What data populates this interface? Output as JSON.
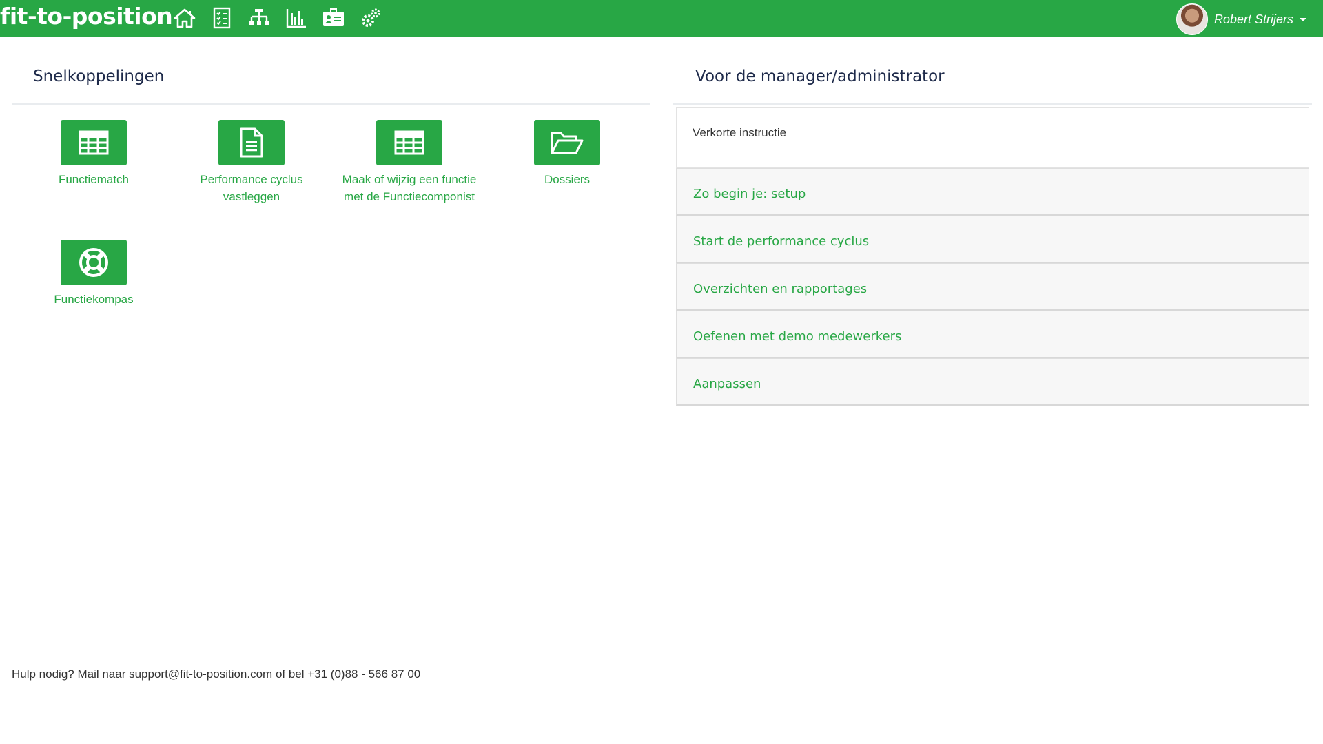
{
  "brand": {
    "logo_text": "fit-to-position",
    "color": "#28a745"
  },
  "nav": {
    "icons": [
      "home-icon",
      "checklist-icon",
      "org-chart-icon",
      "bar-chart-icon",
      "id-card-icon",
      "settings-icon"
    ]
  },
  "user": {
    "name": "Robert Strijers"
  },
  "left": {
    "title": "Snelkoppelingen",
    "tiles": [
      {
        "label": "Functiematch",
        "icon": "table-icon"
      },
      {
        "label": "Performance cyclus vastleggen",
        "icon": "document-icon"
      },
      {
        "label": "Maak of wijzig een functie met de Functiecomponist",
        "icon": "table-icon"
      },
      {
        "label": "Dossiers",
        "icon": "folder-open-icon"
      },
      {
        "label": "Functiekompas",
        "icon": "lifebuoy-icon"
      }
    ]
  },
  "right": {
    "title": "Voor de manager/administrator",
    "card_title": "Verkorte instructie",
    "items": [
      "Zo begin je: setup",
      "Start de performance cyclus",
      "Overzichten en rapportages",
      "Oefenen met demo medewerkers",
      "Aanpassen"
    ]
  },
  "footer": {
    "text": "Hulp nodig? Mail naar support@fit-to-position.com of bel +31 (0)88 - 566 87 00"
  }
}
